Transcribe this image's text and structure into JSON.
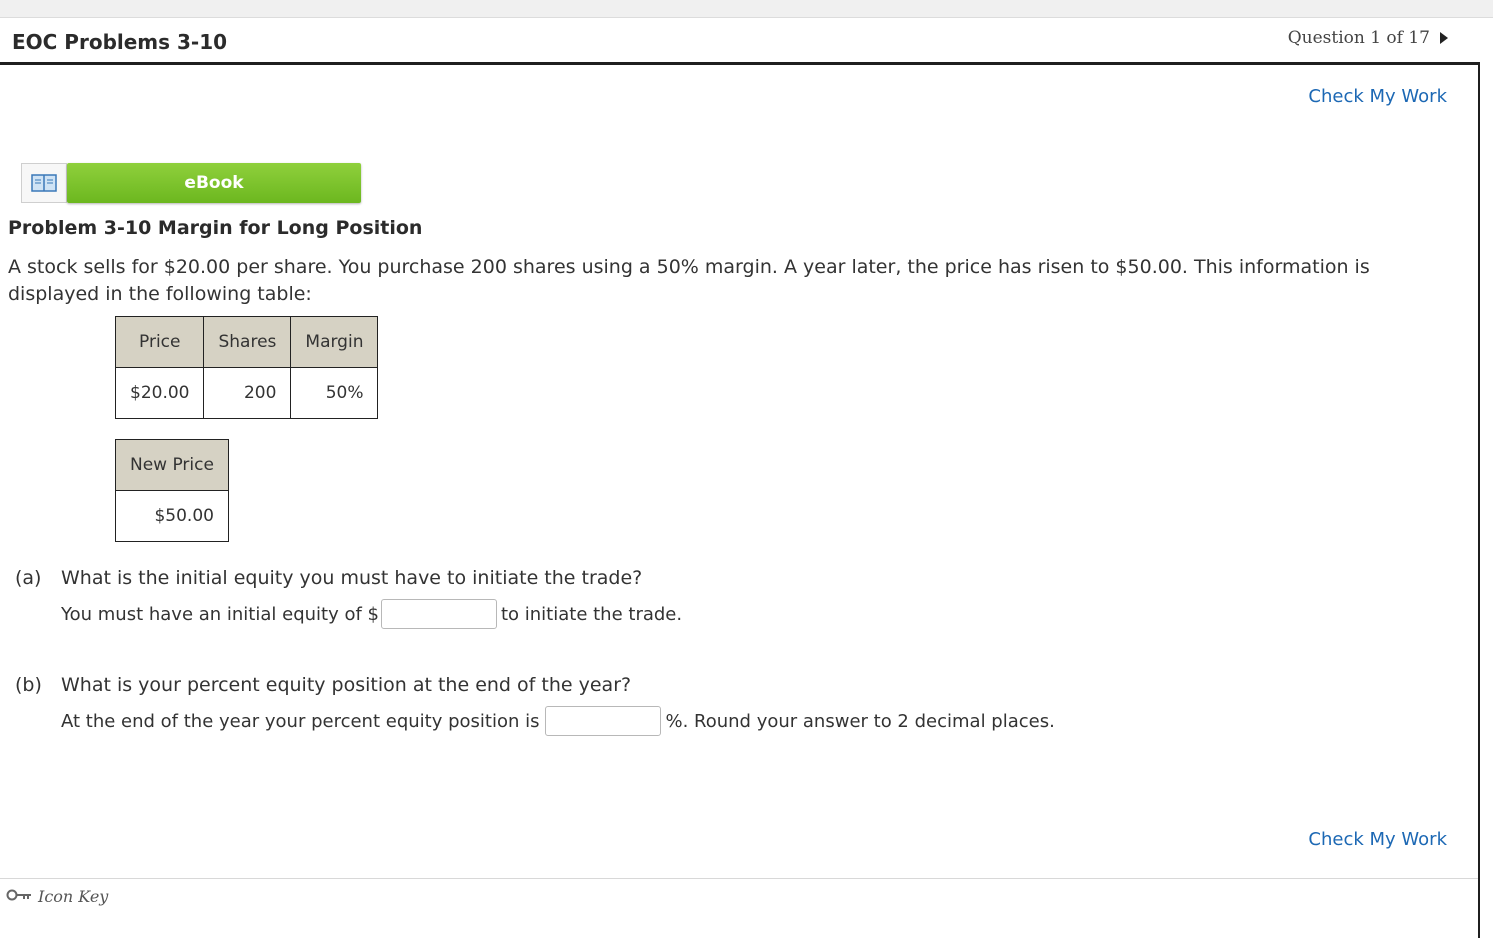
{
  "header": {
    "assignment_title": "EOC Problems 3-10",
    "question_nav": "Question 1 of 17"
  },
  "check_my_work": "Check My Work",
  "ebook": {
    "label": "eBook"
  },
  "problem": {
    "title": "Problem 3-10 Margin for Long Position",
    "text": "A stock sells for $20.00 per share. You purchase 200 shares using a 50% margin. A year later, the price has risen to $50.00. This information is displayed in the following table:"
  },
  "table1": {
    "headers": [
      "Price",
      "Shares",
      "Margin"
    ],
    "row": [
      "$20.00",
      "200",
      "50%"
    ]
  },
  "table2": {
    "headers": [
      "New Price"
    ],
    "row": [
      "$50.00"
    ]
  },
  "parts": [
    {
      "label": "(a)",
      "question": "What is the initial equity you must have to initiate the trade?",
      "prefix": "You must have an initial equity of $",
      "suffix": "to initiate the trade.",
      "value": ""
    },
    {
      "label": "(b)",
      "question": "What is your percent equity position at the end of the year?",
      "prefix": "At the end of the year your percent equity position is",
      "suffix": "%. Round your answer to 2 decimal places.",
      "value": ""
    }
  ],
  "footer": {
    "icon_key": "Icon Key"
  }
}
